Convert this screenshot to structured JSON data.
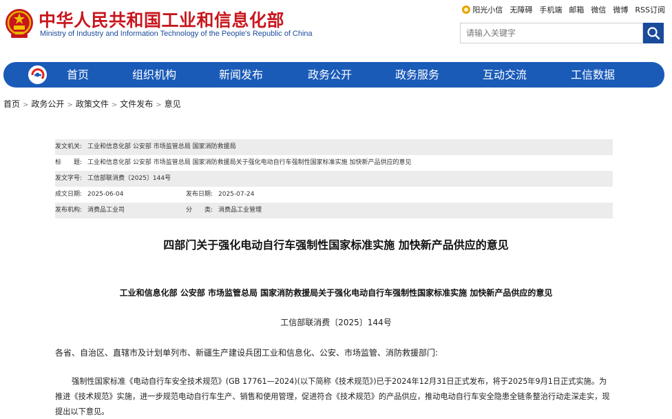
{
  "header": {
    "site_name_cn": "中华人民共和国工业和信息化部",
    "site_name_en": "Ministry of Industry and Information Technology of the People's Republic of China",
    "links": [
      "阳光小信",
      "无障碍",
      "手机端",
      "邮箱",
      "微信",
      "微博",
      "RSS订阅"
    ],
    "search_placeholder": "请输入关键字"
  },
  "nav": {
    "items": [
      "首页",
      "组织机构",
      "新闻发布",
      "政务公开",
      "政务服务",
      "互动交流",
      "工信数据"
    ]
  },
  "breadcrumb": [
    "首页",
    "政务公开",
    "政策文件",
    "文件发布",
    "意见"
  ],
  "meta": {
    "issuer_label": "发文机关:",
    "issuer": "工业和信息化部 公安部 市场监管总局 国家消防救援局",
    "title_label": "标　　题:",
    "title": "工业和信息化部 公安部 市场监管总局 国家消防救援局关于强化电动自行车强制性国家标准实施 加快新产品供应的意见",
    "docno_label": "发文字号:",
    "docno": "工信部联消费〔2025〕144号",
    "created_label": "成文日期:",
    "created": "2025-06-04",
    "published_label": "发布日期:",
    "published": "2025-07-24",
    "org_label": "发布机构:",
    "org": "消费品工业司",
    "category_label": "分　　类:",
    "category": "消费品工业管理"
  },
  "content": {
    "main_title": "四部门关于强化电动自行车强制性国家标准实施 加快新产品供应的意见",
    "sub_title": "工业和信息化部 公安部 市场监管总局 国家消防救援局关于强化电动自行车强制性国家标准实施 加快新产品供应的意见",
    "doc_no": "工信部联消费〔2025〕144号",
    "addressee": "各省、自治区、直辖市及计划单列市、新疆生产建设兵团工业和信息化、公安、市场监管、消防救援部门:",
    "paragraph": "强制性国家标准《电动自行车安全技术规范》(GB 17761—2024)(以下简称《技术规范》)已于2024年12月31日正式发布，将于2025年9月1日正式实施。为推进《技术规范》实施，进一步规范电动自行车生产、销售和使用管理，促进符合《技术规范》的产品供应，推动电动自行车安全隐患全链条整治行动走深走实，现提出以下意见。"
  },
  "colors": {
    "brand_red": "#c8161d",
    "brand_blue": "#1a5bb8",
    "search_button": "#1a4a9c"
  }
}
